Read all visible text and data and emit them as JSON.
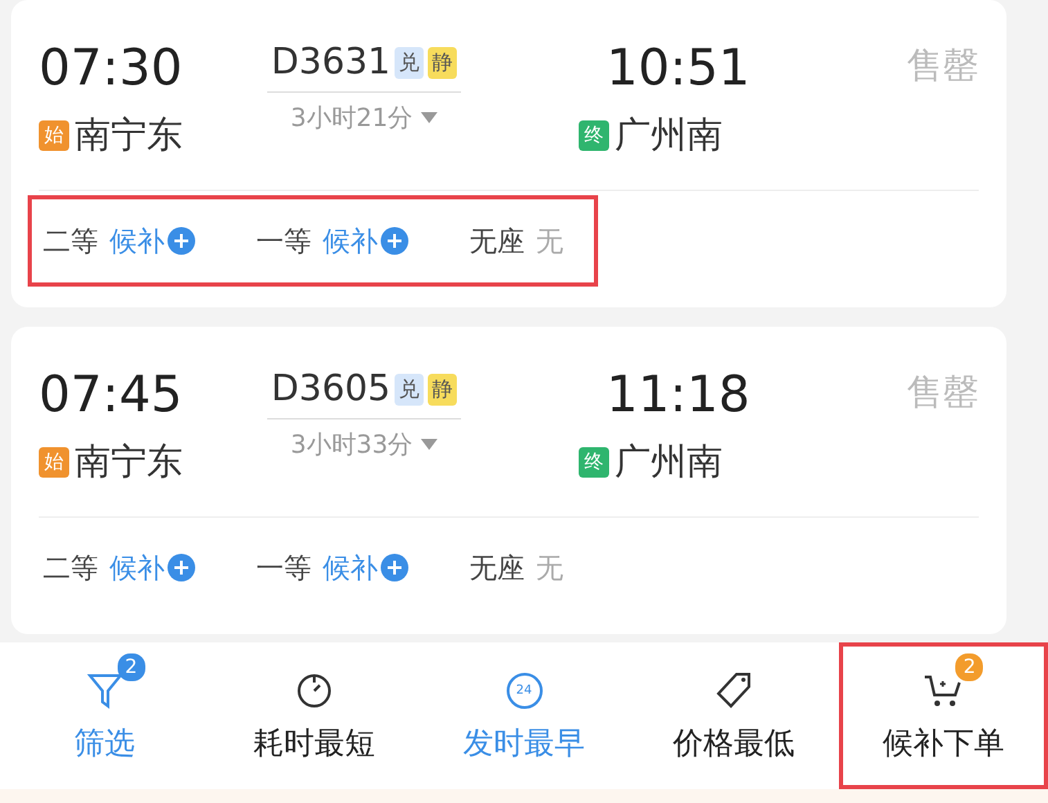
{
  "trains": [
    {
      "depart_time": "07:30",
      "depart_tag": "始",
      "depart_station": "南宁东",
      "train_no": "D3631",
      "tags": [
        {
          "label": "兑",
          "color": "#d6e6fa"
        },
        {
          "label": "静",
          "color": "#f7dc5c"
        }
      ],
      "duration": "3小时21分",
      "arrive_time": "10:51",
      "arrive_tag": "终",
      "arrive_station": "广州南",
      "status": "售罄",
      "seats_highlighted": true,
      "seats": [
        {
          "class": "二等",
          "avail": "候补",
          "kind": "waitlist"
        },
        {
          "class": "一等",
          "avail": "候补",
          "kind": "waitlist"
        },
        {
          "class": "无座",
          "avail": "无",
          "kind": "none"
        }
      ]
    },
    {
      "depart_time": "07:45",
      "depart_tag": "始",
      "depart_station": "南宁东",
      "train_no": "D3605",
      "tags": [
        {
          "label": "兑",
          "color": "#d6e6fa"
        },
        {
          "label": "静",
          "color": "#f7dc5c"
        }
      ],
      "duration": "3小时33分",
      "arrive_time": "11:18",
      "arrive_tag": "终",
      "arrive_station": "广州南",
      "status": "售罄",
      "seats_highlighted": false,
      "seats": [
        {
          "class": "二等",
          "avail": "候补",
          "kind": "waitlist"
        },
        {
          "class": "一等",
          "avail": "候补",
          "kind": "waitlist"
        },
        {
          "class": "无座",
          "avail": "无",
          "kind": "none"
        }
      ]
    }
  ],
  "bottom_bar": [
    {
      "kind": "filter",
      "label": "筛选",
      "badge": "2",
      "selected": true,
      "highlighted": false
    },
    {
      "kind": "timer",
      "label": "耗时最短",
      "selected": false,
      "highlighted": false
    },
    {
      "kind": "clock24",
      "label": "发时最早",
      "icon_text": "24",
      "selected": true,
      "highlighted": false
    },
    {
      "kind": "tag",
      "label": "价格最低",
      "selected": false,
      "highlighted": false
    },
    {
      "kind": "cart",
      "label": "候补下单",
      "badge": "2",
      "selected": false,
      "highlighted": true
    }
  ]
}
